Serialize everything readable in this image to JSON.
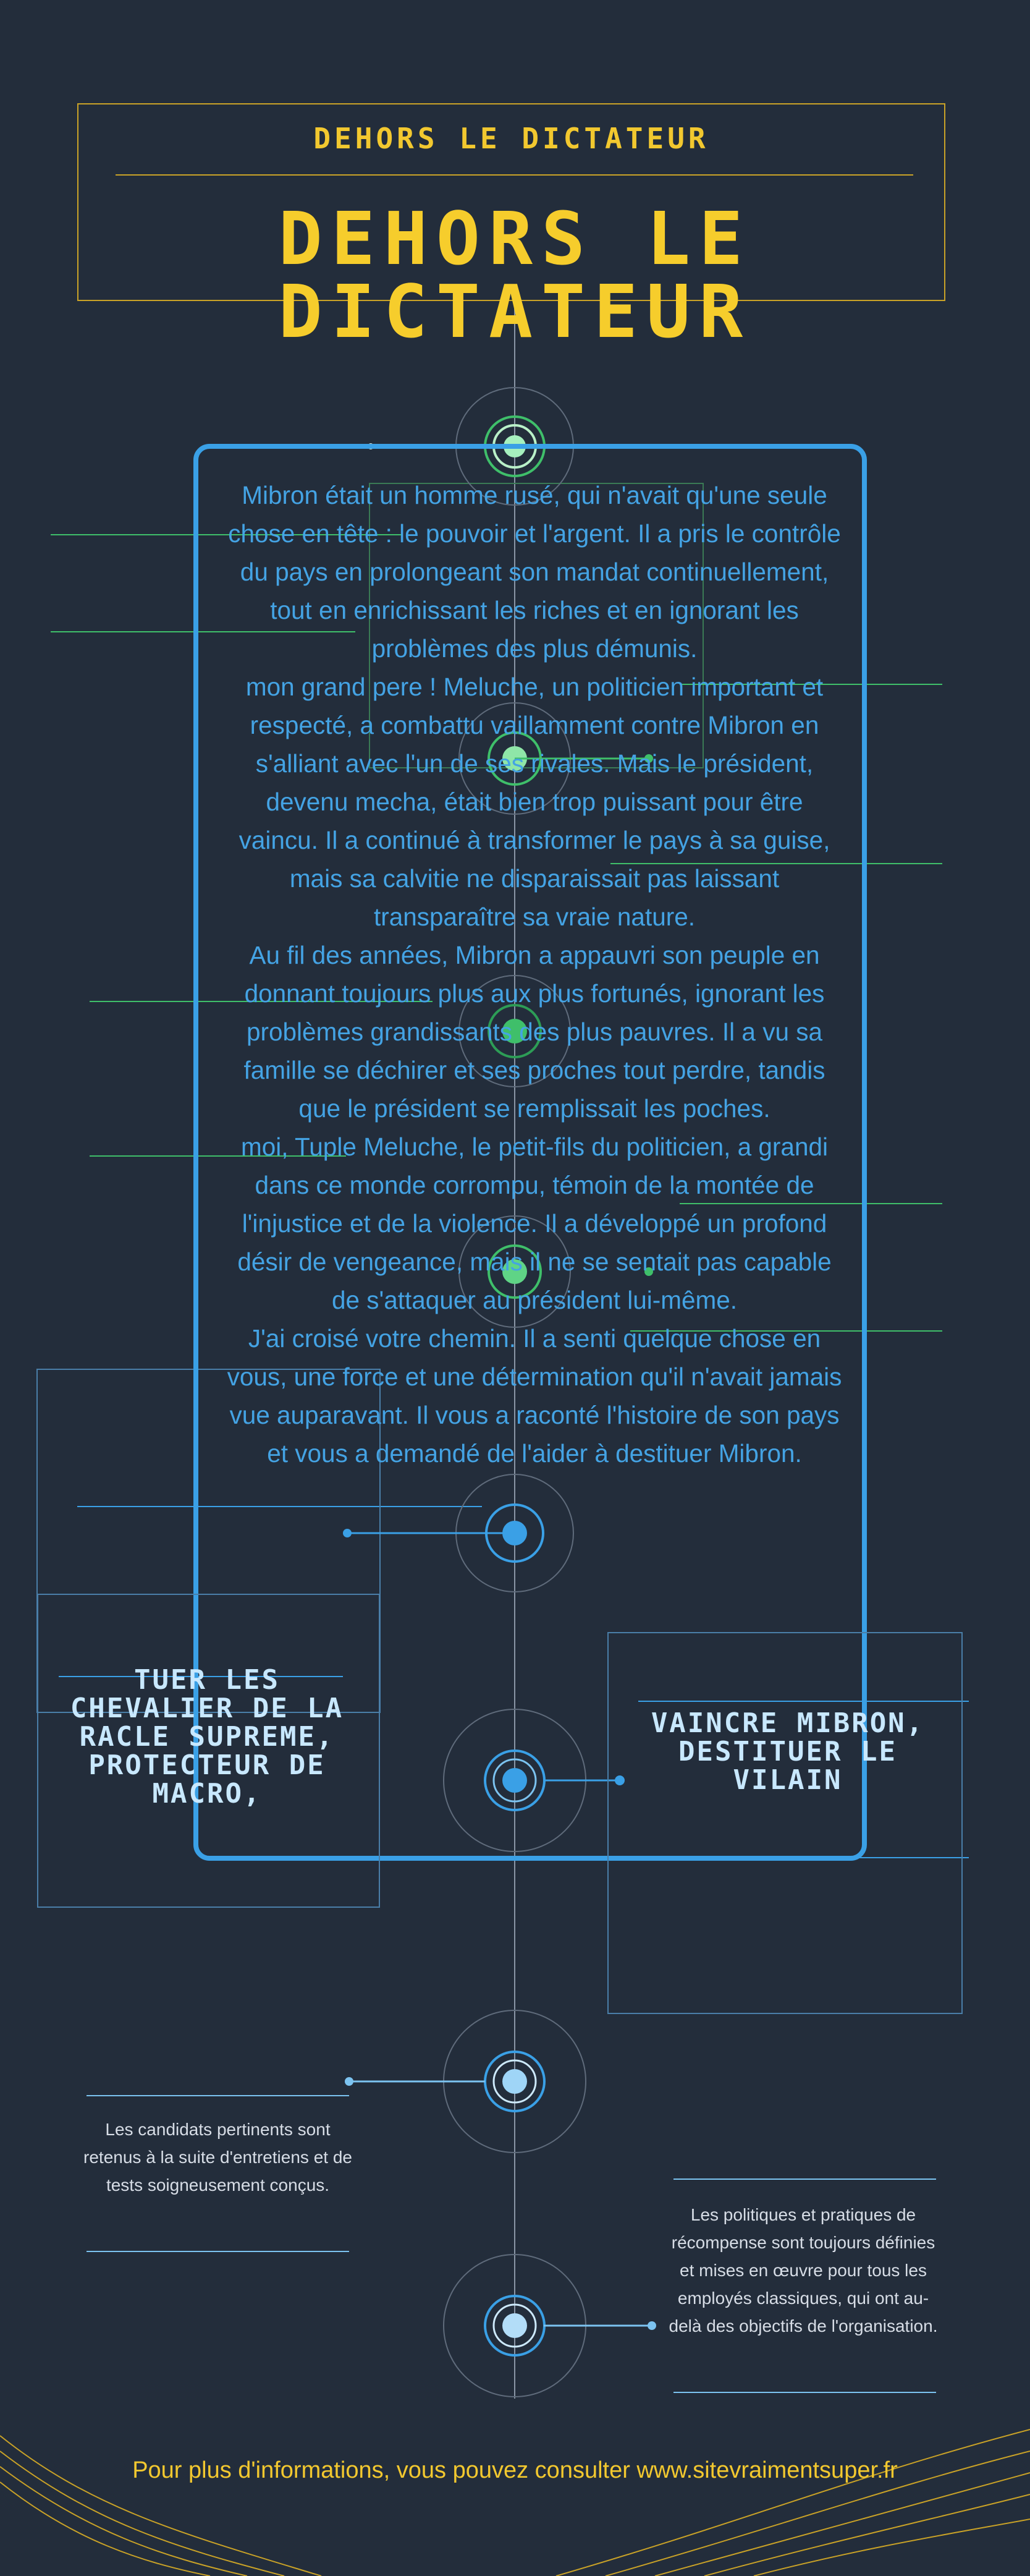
{
  "header": {
    "small_title": "DEHORS LE DICTATEUR",
    "big_title_line1": "DEHORS LE",
    "big_title_line2": "DICTATEUR"
  },
  "story": {
    "paragraphs": [
      "Mibron était un homme rusé, qui n'avait qu'une seule chose en tête : le pouvoir et l'argent. Il a pris le contrôle du pays en prolongeant son mandat continuellement, tout en enrichissant les riches et en ignorant les problèmes des plus démunis.",
      "mon grand pere ! Meluche, un politicien important et respecté, a combattu vaillamment contre Mibron en s'alliant avec l'un de ses rivales. Mais le président, devenu mecha, était bien trop puissant pour être vaincu. Il a continué à transformer le pays à sa guise, mais sa calvitie ne disparaissait pas laissant transparaître sa vraie nature.",
      "Au fil des années, Mibron a appauvri son peuple en donnant toujours plus aux plus fortunés, ignorant les problèmes grandissants des plus pauvres. Il a vu sa famille se déchirer et ses proches tout perdre, tandis que le président se remplissait les poches.",
      "moi, Tuple Meluche, le petit-fils du politicien, a grandi dans ce monde corrompu, témoin de la montée de l'injustice et de la violence. Il a développé un profond désir de vengeance, mais il ne se sentait pas capable de s'attaquer au président lui-même.",
      "J'ai croisé votre chemin. Il a senti quelque chose en vous, une force et une détermination qu'il n'avait jamais vue auparavant. Il vous a raconté l'histoire de son pays et vous a demandé de l'aider à destituer Mibron."
    ]
  },
  "cards": {
    "left_title": "TUER LES CHEVALIER DE LA RACLE SUPREME, PROTECTEUR DE MACRO,",
    "right_title": "VAINCRE MIBRON, DESTITUER LE VILAIN"
  },
  "notes": {
    "left": "Les candidats pertinents sont retenus à la suite d'entretiens et de tests soigneusement conçus.",
    "right": "Les politiques et pratiques de récompense sont toujours définies et mises en œuvre pour tous les employés classiques, qui ont au-delà des objectifs de l'organisation."
  },
  "footer": {
    "text": "Pour plus d'informations, vous pouvez consulter www.sitevraimentsuper.fr"
  },
  "colors": {
    "background": "#232d3b",
    "gold": "#f2c82f",
    "blue": "#3aa0e6",
    "green": "#3fbf6a"
  }
}
